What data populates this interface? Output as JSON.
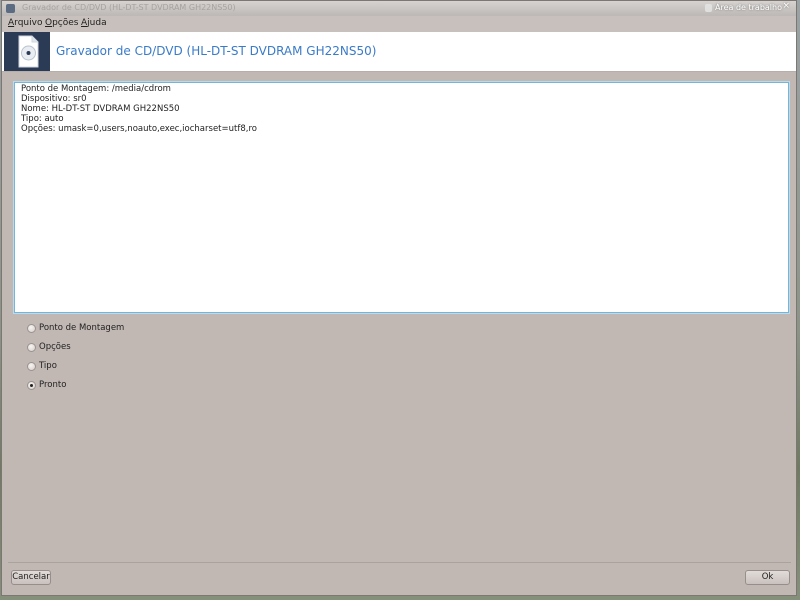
{
  "titlebar": {
    "title": "Gravador de CD/DVD (HL-DT-ST DVDRAM GH22NS50)",
    "workspace": "Área de trabalho",
    "close": "×"
  },
  "menu": {
    "items": [
      {
        "underline": "A",
        "rest": "rquivo"
      },
      {
        "underline": "O",
        "rest": "pções"
      },
      {
        "underline": "A",
        "rest": "juda"
      }
    ]
  },
  "banner": {
    "heading": "Gravador de CD/DVD (HL-DT-ST DVDRAM GH22NS50)"
  },
  "info": {
    "lines": [
      "Ponto de Montagem: /media/cdrom",
      "Dispositivo: sr0",
      "Nome: HL-DT-ST DVDRAM GH22NS50",
      "Tipo: auto",
      "Opções: umask=0,users,noauto,exec,iocharset=utf8,ro"
    ]
  },
  "options": [
    {
      "label": "Ponto de Montagem",
      "selected": false
    },
    {
      "label": "Opções",
      "selected": false
    },
    {
      "label": "Tipo",
      "selected": false
    },
    {
      "label": "Pronto",
      "selected": true
    }
  ],
  "buttons": {
    "cancel": "Cancelar",
    "ok": "Ok"
  },
  "colors": {
    "heading": "#3a7bc8",
    "window_bg": "#c1b8b4",
    "banner_logo": "#2b3a55",
    "info_border": "#78b4d8"
  }
}
